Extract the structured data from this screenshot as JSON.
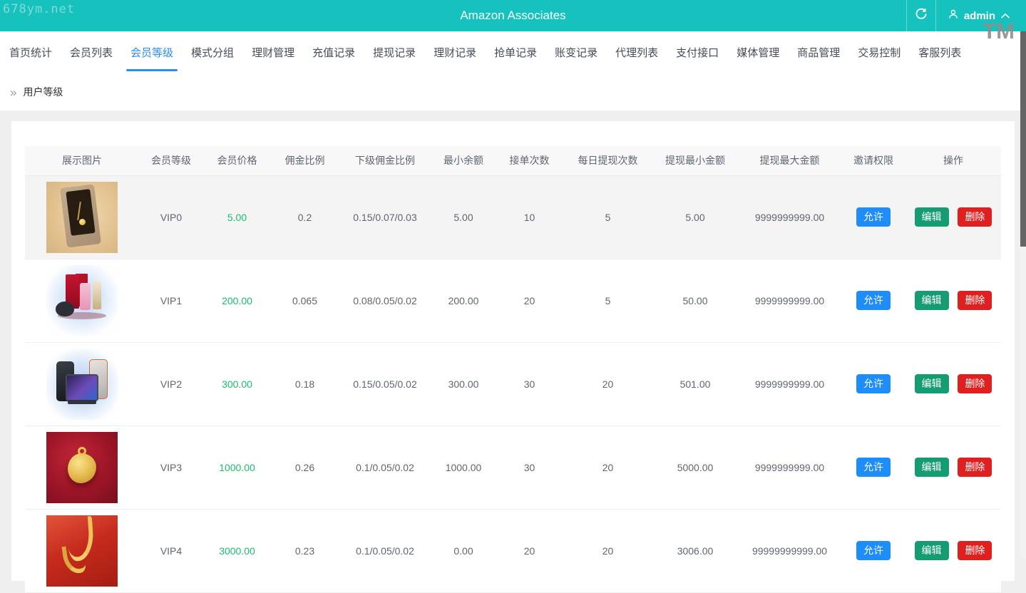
{
  "watermarks": {
    "site": "678ym.net",
    "tm": "TM"
  },
  "header": {
    "title": "Amazon Associates",
    "username": "admin"
  },
  "nav": {
    "items": [
      {
        "label": "首页统计",
        "active": false
      },
      {
        "label": "会员列表",
        "active": false
      },
      {
        "label": "会员等级",
        "active": true
      },
      {
        "label": "模式分组",
        "active": false
      },
      {
        "label": "理财管理",
        "active": false
      },
      {
        "label": "充值记录",
        "active": false
      },
      {
        "label": "提现记录",
        "active": false
      },
      {
        "label": "理财记录",
        "active": false
      },
      {
        "label": "抢单记录",
        "active": false
      },
      {
        "label": "账变记录",
        "active": false
      },
      {
        "label": "代理列表",
        "active": false
      },
      {
        "label": "支付接口",
        "active": false
      },
      {
        "label": "媒体管理",
        "active": false
      },
      {
        "label": "商品管理",
        "active": false
      },
      {
        "label": "交易控制",
        "active": false
      },
      {
        "label": "客服列表",
        "active": false
      }
    ]
  },
  "breadcrumb": {
    "icon": "»",
    "label": "用户等级"
  },
  "table": {
    "columns": [
      "展示图片",
      "会员等级",
      "会员价格",
      "佣金比例",
      "下级佣金比例",
      "最小余额",
      "接单次数",
      "每日提现次数",
      "提现最小金额",
      "提现最大金额",
      "邀请权限",
      "操作"
    ],
    "actions": {
      "allow": "允许",
      "edit": "编辑",
      "delete": "删除"
    },
    "rows": [
      {
        "image": "necklace-gift-box",
        "level": "VIP0",
        "price": "5.00",
        "commission": "0.2",
        "sub_commission": "0.15/0.07/0.03",
        "min_balance": "5.00",
        "order_count": "10",
        "daily_withdrawals": "5",
        "min_withdrawal": "5.00",
        "max_withdrawal": "9999999999.00"
      },
      {
        "image": "cosmetics-set",
        "level": "VIP1",
        "price": "200.00",
        "commission": "0.065",
        "sub_commission": "0.08/0.05/0.02",
        "min_balance": "200.00",
        "order_count": "20",
        "daily_withdrawals": "5",
        "min_withdrawal": "50.00",
        "max_withdrawal": "9999999999.00"
      },
      {
        "image": "smartphones-set",
        "level": "VIP2",
        "price": "300.00",
        "commission": "0.18",
        "sub_commission": "0.15/0.05/0.02",
        "min_balance": "300.00",
        "order_count": "30",
        "daily_withdrawals": "20",
        "min_withdrawal": "501.00",
        "max_withdrawal": "9999999999.00"
      },
      {
        "image": "gold-pendant",
        "level": "VIP3",
        "price": "1000.00",
        "commission": "0.26",
        "sub_commission": "0.1/0.05/0.02",
        "min_balance": "1000.00",
        "order_count": "30",
        "daily_withdrawals": "20",
        "min_withdrawal": "5000.00",
        "max_withdrawal": "9999999999.00"
      },
      {
        "image": "gold-necklace",
        "level": "VIP4",
        "price": "3000.00",
        "commission": "0.23",
        "sub_commission": "0.1/0.05/0.02",
        "min_balance": "0.00",
        "order_count": "20",
        "daily_withdrawals": "20",
        "min_withdrawal": "3006.00",
        "max_withdrawal": "99999999999.00"
      }
    ]
  },
  "colors": {
    "header_teal": "#16c2bd",
    "active_blue": "#2d8cf0",
    "price_green": "#19be6b",
    "allow_blue": "#1d8dfb",
    "edit_green": "#159c73",
    "delete_red": "#e01f1f"
  }
}
